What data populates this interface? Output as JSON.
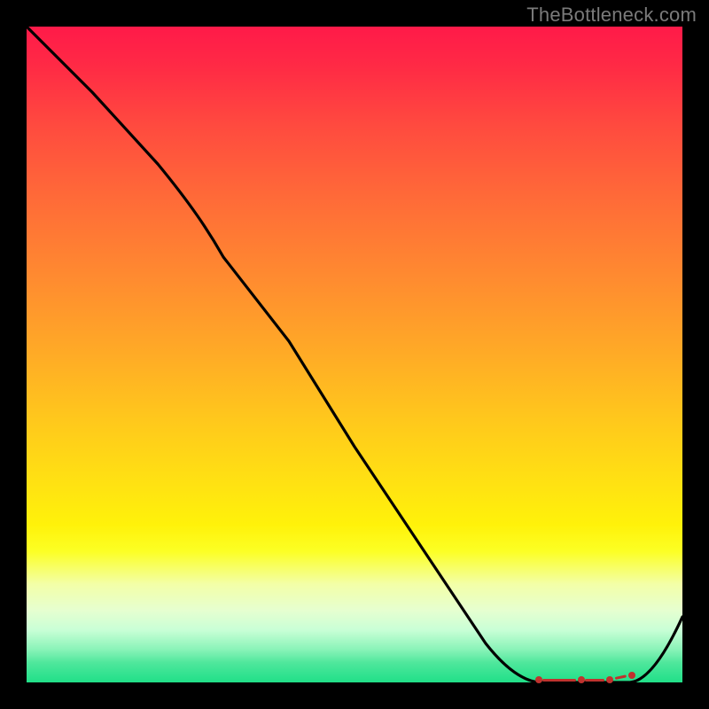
{
  "watermark": "TheBottleneck.com",
  "colors": {
    "background": "#000000",
    "line": "#000000",
    "marker": "#c0322e",
    "gradient_top": "#ff1a49",
    "gradient_bottom": "#21df88"
  },
  "chart_data": {
    "type": "line",
    "title": "",
    "xlabel": "",
    "ylabel": "",
    "xlim": [
      0,
      100
    ],
    "ylim": [
      0,
      100
    ],
    "grid": false,
    "series": [
      {
        "name": "curve",
        "x": [
          0,
          10,
          20,
          30,
          40,
          50,
          60,
          70,
          78,
          83,
          88,
          92,
          100
        ],
        "y": [
          100,
          90,
          79,
          68,
          52,
          36,
          21,
          6,
          0,
          0,
          0,
          0,
          10
        ]
      }
    ],
    "markers": {
      "name": "highlight-range",
      "x_start": 78,
      "x_end": 92,
      "y": 0
    },
    "background_gradient": {
      "orientation": "vertical",
      "stops": [
        {
          "pos": 0.0,
          "color": "#ff1a49"
        },
        {
          "pos": 0.5,
          "color": "#ffab26"
        },
        {
          "pos": 0.78,
          "color": "#fcff24"
        },
        {
          "pos": 1.0,
          "color": "#21df88"
        }
      ]
    }
  }
}
